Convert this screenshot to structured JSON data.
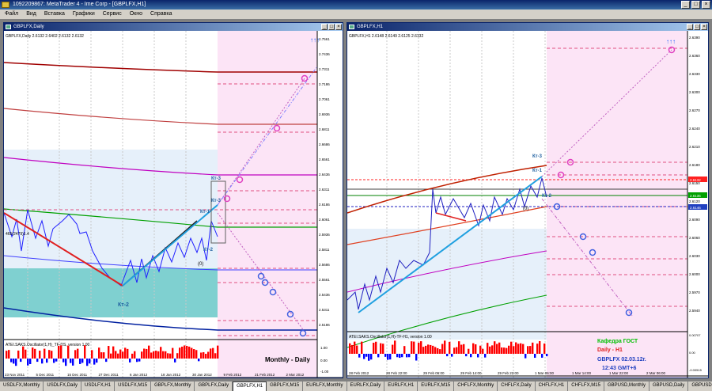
{
  "app": {
    "title": "1092209867: MetaTrader 4 - Ime Corp - [GBPLFX,H1]"
  },
  "menu": [
    "Файл",
    "Вид",
    "Вставка",
    "Графики",
    "Сервис",
    "Окно",
    "Справка"
  ],
  "left_chart": {
    "window_title": "GBPLFX,Daily",
    "info_line": "GBPLFX,Daily  2.6132 2.6402 2.6132 2.6132",
    "price_labels": [
      "2.7561",
      "2.7436",
      "2.7311",
      "2.7186",
      "2.7061",
      "2.6936",
      "2.6811",
      "2.6686",
      "2.6561",
      "2.6436",
      "2.6311",
      "2.6186",
      "2.6061",
      "2.5936",
      "2.5811",
      "2.5686",
      "2.5561",
      "2.5436",
      "2.5311",
      "2.5186"
    ],
    "date_labels": [
      "23 Nov 2011",
      "5 Dec 2011",
      "15 Dec 2011",
      "27 Dec 2011",
      "6 Jan 2012",
      "18 Jan 2012",
      "30 Jan 2012",
      "9 Feb 2012",
      "21 Feb 2012",
      "2 Mar 2012"
    ],
    "kt_labels": [
      "Кт-3",
      "Кт-3",
      "Кт-1",
      "Кт-2",
      "Кт-2"
    ],
    "point_label": "(0)",
    "mark_label": "465(2479)1.4",
    "arrows": "↑↑↑",
    "oscillator_title": "ATEI.SAKS.Oscillator(1,H)_TF-DS, version 1.00",
    "osc_labels": [
      "1.00",
      "0.00",
      "-1.00"
    ],
    "caption": "Monthly - Daily"
  },
  "right_chart": {
    "window_title": "GBPLFX,H1",
    "info_line": "GBPLFX,H1  2.6148 2.6149 2.6125 2.6132",
    "price_labels": [
      "2.6390",
      "2.6360",
      "2.6330",
      "2.6300",
      "2.6270",
      "2.6240",
      "2.6210",
      "2.6180",
      "2.6150",
      "2.6120",
      "2.6090",
      "2.6060",
      "2.6030",
      "2.6000",
      "2.5970",
      "2.5940"
    ],
    "date_labels": [
      "28 Feb 2012",
      "28 Feb 22:00",
      "29 Feb 06:00",
      "29 Feb 14:00",
      "29 Feb 22:00",
      "1 Mar 06:00",
      "1 Mar 14:00",
      "1 Mar 22:00",
      "2 Mar 06:00"
    ],
    "kt_labels": [
      "Кт-3",
      "Кт-1",
      "Кт-2"
    ],
    "point_label": "(0)",
    "arrows": "↑↑↑",
    "oscillator_title": "ATEI.SAKS.Oscillator(1,H)-TF-H1, version 1.00",
    "osc_labels": [
      "0.00707",
      "0.00",
      "-0.00515"
    ],
    "info_box": [
      "Кафедра ГОСТ",
      "Daily - H1",
      "GBPLFX 02.03.12г.",
      "12:43 GMT+6"
    ],
    "level_tags": [
      "2.6132",
      "2.6135",
      "2.6146"
    ]
  },
  "tabs": [
    "USDLFX,Monthly",
    "USDLFX,Daily",
    "USDLFX,H1",
    "USDLFX,M15",
    "GBPLFX,Monthly",
    "GBPLFX,Daily",
    "GBPLFX,H1",
    "GBPLFX,M15",
    "EURLFX,Monthly",
    "EURLFX,Daily",
    "EURLFX,H1",
    "EURLFX,M15",
    "CHFLFX,Monthly",
    "CHFLFX,Daily",
    "CHFLFX,H1",
    "CHFLFX,M15",
    "GBPUSD,Monthly",
    "GBPUSD,Daily",
    "GBPUSD,H1",
    "GBPUSD,M15"
  ],
  "active_tab_index": 6,
  "colors": {
    "pink_zone": "#fce4f6",
    "blue_zone": "#e6f0fa",
    "teal_zone": "#7fd0d0",
    "osc_up": "#ff0000",
    "osc_down": "#0000ff"
  }
}
